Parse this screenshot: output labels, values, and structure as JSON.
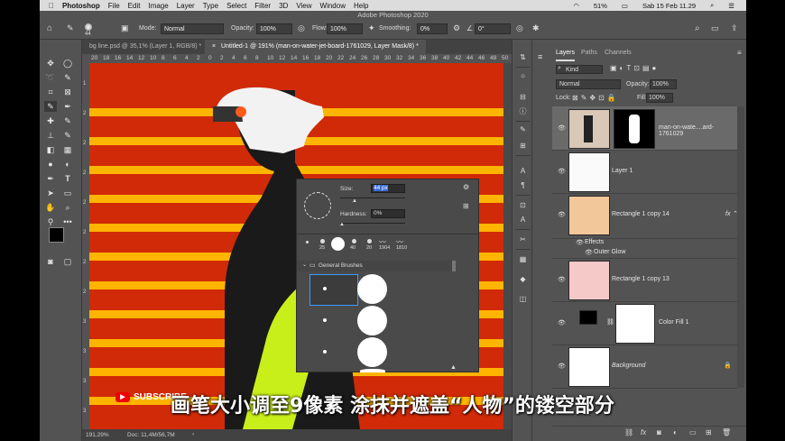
{
  "menubar": {
    "app": "Photoshop",
    "items": [
      "File",
      "Edit",
      "Image",
      "Layer",
      "Type",
      "Select",
      "Filter",
      "3D",
      "View",
      "Window",
      "Help"
    ],
    "battery": "51%",
    "datetime": "Sab 15 Feb 11.29"
  },
  "window_title": "Adobe Photoshop 2020",
  "options_bar": {
    "brush_size": "44",
    "mode_label": "Mode:",
    "mode_value": "Normal",
    "opacity_label": "Opacity:",
    "opacity_value": "100%",
    "flow_label": "Flow:",
    "flow_value": "100%",
    "smoothing_label": "Smoothing:",
    "smoothing_value": "0%",
    "angle_value": "0°"
  },
  "tabs": [
    {
      "label": "bg line.psd @ 35,1% (Layer 1, RGB/8) *"
    },
    {
      "label": "Untitled-1 @ 191% (man-on-water-jet-board-1761029, Layer Mask/8) *"
    }
  ],
  "ruler_h": [
    "20",
    "18",
    "16",
    "14",
    "12",
    "10",
    "8",
    "6",
    "4",
    "2",
    "0",
    "2",
    "4",
    "6",
    "8",
    "10",
    "12",
    "14",
    "16",
    "18",
    "20",
    "22",
    "24",
    "26",
    "28",
    "30",
    "32",
    "34",
    "36",
    "38",
    "40",
    "42",
    "44",
    "46",
    "48",
    "50"
  ],
  "ruler_v": [
    "1",
    "2",
    "2",
    "2",
    "2",
    "2",
    "2",
    "2",
    "3",
    "3",
    "3",
    "3"
  ],
  "status": {
    "zoom": "191,29%",
    "doc": "Doc: 11,4M/56,7M"
  },
  "brush_popup": {
    "size_label": "Size:",
    "size_value": "44 px",
    "hardness_label": "Hardness:",
    "hardness_value": "0%",
    "presets": [
      "25",
      "",
      "40",
      "20",
      "1904",
      "1810"
    ],
    "group": "General Brushes"
  },
  "panels": {
    "tabs": [
      "Layers",
      "Paths",
      "Channels"
    ],
    "kind_value": "Kind",
    "blend_mode": "Normal",
    "opacity_label": "Opacity:",
    "opacity_value": "100%",
    "lock_label": "Lock:",
    "fill_label": "Fill:",
    "fill_value": "100%",
    "layers": [
      {
        "name": "man-on-wate....ard-1761029"
      },
      {
        "name": "Layer 1"
      },
      {
        "name": "Rectangle 1 copy 14",
        "fx": "fx"
      },
      {
        "name": "Effects"
      },
      {
        "name": "Outer Glow"
      },
      {
        "name": "Rectangle 1 copy 13"
      },
      {
        "name": "Color Fill 1"
      },
      {
        "name": "Background"
      }
    ]
  },
  "overlay": {
    "logo_text": "SUBSCRIBE",
    "subtitle": "画笔大小调至9像素 涂抹并遮盖“人物”的镂空部分"
  },
  "colors": {
    "canvas_red": "#d02a08",
    "stripe_yellow": "#ffb400",
    "ui_gray": "#535353"
  }
}
